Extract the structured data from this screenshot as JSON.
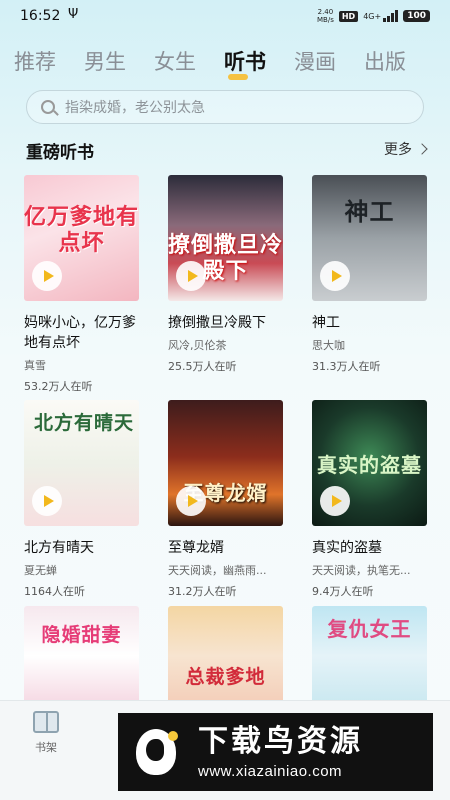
{
  "status_bar": {
    "time": "16:52",
    "usb_symbol": "Ψ",
    "net_speed_value": "2.40",
    "net_speed_unit": "MB/s",
    "hd_label": "HD",
    "signal_label": "4G+",
    "battery": "100"
  },
  "tabs": [
    {
      "label": "推荐",
      "active": false
    },
    {
      "label": "男生",
      "active": false
    },
    {
      "label": "女生",
      "active": false
    },
    {
      "label": "听书",
      "active": true
    },
    {
      "label": "漫画",
      "active": false
    },
    {
      "label": "出版",
      "active": false
    }
  ],
  "search": {
    "placeholder": "指染成婚，老公别太急"
  },
  "section": {
    "title": "重磅听书",
    "more_label": "更多"
  },
  "books": [
    {
      "title": "妈咪小心，亿万爹地有点坏",
      "author": "真雪",
      "listeners": "53.2万人在听",
      "cover_text": "亿万爹地有点坏"
    },
    {
      "title": "撩倒撒旦冷殿下",
      "author": "风冷,贝伦茶",
      "listeners": "25.5万人在听",
      "cover_text": "撩倒撒旦冷殿下"
    },
    {
      "title": "神工",
      "author": "思大咖",
      "listeners": "31.3万人在听",
      "cover_text": "神工"
    },
    {
      "title": "北方有晴天",
      "author": "夏无蝉",
      "listeners": "1164人在听",
      "cover_text": "北方有晴天"
    },
    {
      "title": "至尊龙婿",
      "author": "天天阅读，幽燕雨...",
      "listeners": "31.2万人在听",
      "cover_text": "至尊龙婿"
    },
    {
      "title": "真实的盗墓",
      "author": "天天阅读，执笔无...",
      "listeners": "9.4万人在听",
      "cover_text": "真实的盗墓"
    },
    {
      "title": "",
      "author": "",
      "listeners": "",
      "cover_text": "隐婚甜妻"
    },
    {
      "title": "",
      "author": "",
      "listeners": "",
      "cover_text": "总裁爹地"
    },
    {
      "title": "",
      "author": "",
      "listeners": "",
      "cover_text": "复仇女王"
    }
  ],
  "bottom_nav": {
    "shelf_label": "书架"
  },
  "watermark": {
    "title": "下载鸟资源",
    "url": "www.xiazainiao.com"
  },
  "colors": {
    "accent": "#f5c242",
    "play": "#f2b81c"
  }
}
